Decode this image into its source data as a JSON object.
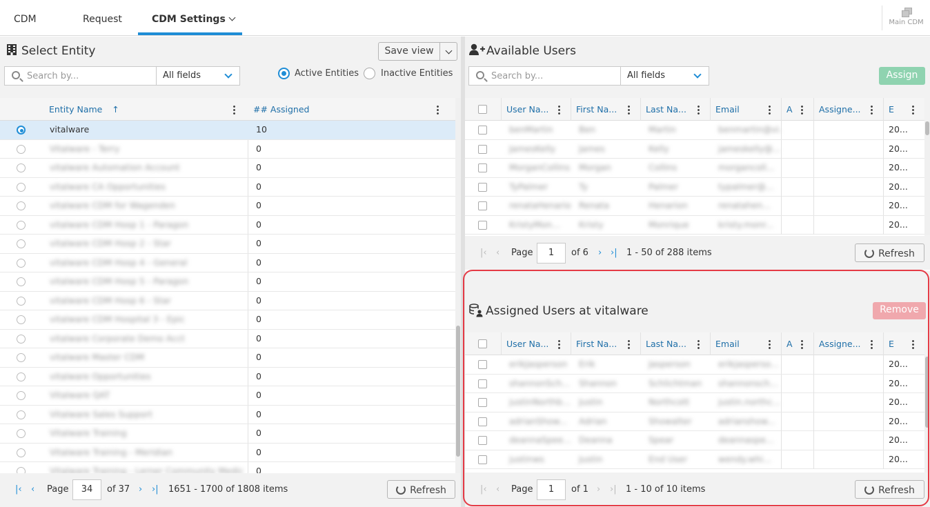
{
  "tabs": [
    {
      "label": "CDM"
    },
    {
      "label": "Request"
    },
    {
      "label": "CDM Settings"
    }
  ],
  "main_cdm": {
    "label": "Main CDM"
  },
  "entity": {
    "title": "Select Entity",
    "save_view": "Save view",
    "search_placeholder": "Search by...",
    "field_select": "All fields",
    "radio_active": "Active Entities",
    "radio_inactive": "Inactive Entities",
    "col_name": "Entity Name",
    "col_assigned": "## Assigned",
    "rows": [
      {
        "name": "vitalware",
        "assigned": "10"
      },
      {
        "name": "Vitalware - Terry",
        "assigned": "0"
      },
      {
        "name": "vitalware Automation Account",
        "assigned": "0"
      },
      {
        "name": "vitalware CA Opportunities",
        "assigned": "0"
      },
      {
        "name": "vitalware CDM for Wagenden",
        "assigned": "0"
      },
      {
        "name": "vitalware CDM Hosp 1 - Paragon",
        "assigned": "0"
      },
      {
        "name": "vitalware CDM Hosp 2 - Star",
        "assigned": "0"
      },
      {
        "name": "vitalware CDM Hosp 4 - General",
        "assigned": "0"
      },
      {
        "name": "vitalware CDM Hosp 5 - Paragon",
        "assigned": "0"
      },
      {
        "name": "vitalware CDM Hosp 6 - Star",
        "assigned": "0"
      },
      {
        "name": "vitalware CDM Hospital 3 - Epic",
        "assigned": "0"
      },
      {
        "name": "vitalware Corporate Demo Acct",
        "assigned": "0"
      },
      {
        "name": "vitalware Master CDM",
        "assigned": "0"
      },
      {
        "name": "vitalware Opportunities",
        "assigned": "0"
      },
      {
        "name": "Vitalware QAT",
        "assigned": "0"
      },
      {
        "name": "Vitalware Sales Support",
        "assigned": "0"
      },
      {
        "name": "Vitalware Training",
        "assigned": "0"
      },
      {
        "name": "Vitalware Training - Meridian",
        "assigned": "0"
      },
      {
        "name": "Vitalware Training - Lerner Community Medic",
        "assigned": "0"
      }
    ],
    "pager": {
      "page_label": "Page",
      "page": "34",
      "of": "of 37",
      "summary": "1651 - 1700 of 1808 items",
      "refresh": "Refresh"
    }
  },
  "available": {
    "title": "Available Users",
    "search_placeholder": "Search by...",
    "field_select": "All fields",
    "assign": "Assign",
    "columns": [
      "User Na...",
      "First Na...",
      "Last Na...",
      "Email",
      "A",
      "Assigne...",
      "E"
    ],
    "rows": [
      {
        "user": "benMartin",
        "first": "Ben",
        "last": "Martin",
        "email": "benmartin@vi...",
        "e": "20..."
      },
      {
        "user": "JamesKelly",
        "first": "James",
        "last": "Kelly",
        "email": "jameskelly@...",
        "e": "20..."
      },
      {
        "user": "MorganCollins",
        "first": "Morgan",
        "last": "Collins",
        "email": "morgancoll...",
        "e": "20..."
      },
      {
        "user": "TyPalmer",
        "first": "Ty",
        "last": "Palmer",
        "email": "typalmer@...",
        "e": "20..."
      },
      {
        "user": "renataHenarion",
        "first": "Renata",
        "last": "Henarion",
        "email": "renatahen...",
        "e": "20..."
      },
      {
        "user": "KristyMon...",
        "first": "Kristy",
        "last": "Monrique",
        "email": "kristy.monr...",
        "e": "20..."
      }
    ],
    "pager": {
      "page_label": "Page",
      "page": "1",
      "of": "of 6",
      "summary": "1 - 50 of 288 items",
      "refresh": "Refresh"
    }
  },
  "assigned": {
    "title": "Assigned Users at vitalware",
    "remove": "Remove",
    "columns": [
      "User Na...",
      "First Na...",
      "Last Na...",
      "Email",
      "A",
      "Assigne...",
      "E"
    ],
    "rows": [
      {
        "user": "erikJasperson",
        "first": "Erik",
        "last": "Jasperson",
        "email": "erikjasperso...",
        "e": "20..."
      },
      {
        "user": "shannonSch...",
        "first": "Shannon",
        "last": "Schlichtman",
        "email": "shannonsch...",
        "e": "20..."
      },
      {
        "user": "justinNorthb...",
        "first": "Justin",
        "last": "Northcott",
        "email": "justin.northc...",
        "e": "20..."
      },
      {
        "user": "adrianShow...",
        "first": "Adrian",
        "last": "Showalter",
        "email": "adrianshow...",
        "e": "20..."
      },
      {
        "user": "deannaSpee...",
        "first": "Deanna",
        "last": "Spear",
        "email": "deannaspe...",
        "e": "20..."
      },
      {
        "user": "justinws",
        "first": "Justin",
        "last": "End User",
        "email": "wendy.whi...",
        "e": "20..."
      }
    ],
    "pager": {
      "page_label": "Page",
      "page": "1",
      "of": "of 1",
      "summary": "1 - 10 of 10 items",
      "refresh": "Refresh"
    }
  },
  "colors": {
    "accent": "#1f8dd6",
    "assign_btn": "#8fd3b0",
    "remove_btn": "#f0a8ad",
    "highlight_border": "#e53a45"
  }
}
